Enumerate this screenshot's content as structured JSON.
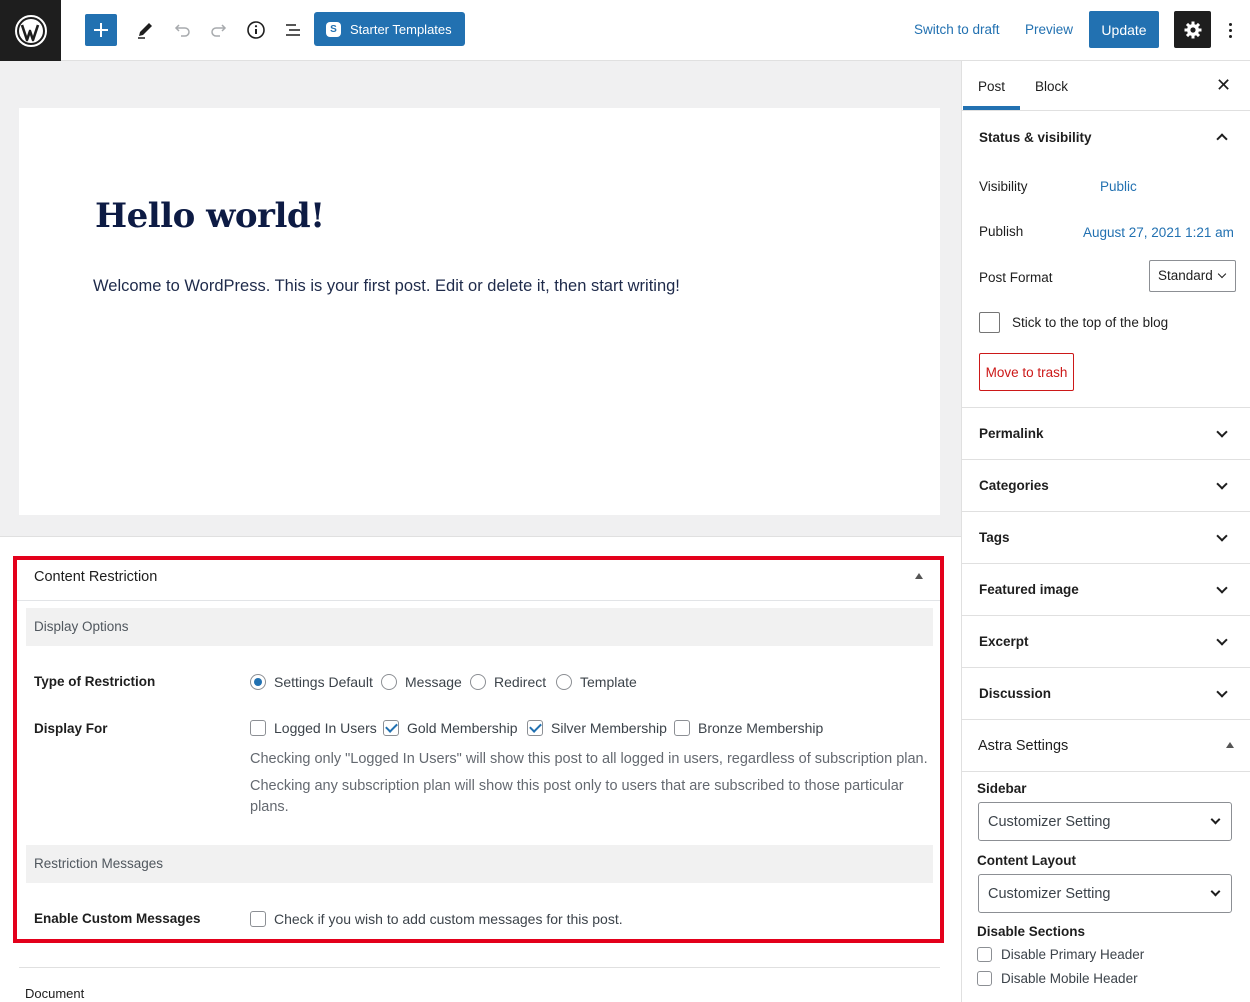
{
  "toolbar": {
    "starter_templates_label": "Starter Templates",
    "switch_to_draft_label": "Switch to draft",
    "preview_label": "Preview",
    "update_label": "Update"
  },
  "post": {
    "title": "Hello world!",
    "body": "Welcome to WordPress. This is your first post. Edit or delete it, then start writing!"
  },
  "content_restriction": {
    "title": "Content Restriction",
    "display_options_section": "Display Options",
    "type_label": "Type of Restriction",
    "type_options": [
      "Settings Default",
      "Message",
      "Redirect",
      "Template"
    ],
    "type_selected": "Settings Default",
    "display_for_label": "Display For",
    "display_for_options": [
      "Logged In Users",
      "Gold Membership",
      "Silver Membership",
      "Bronze Membership"
    ],
    "display_for_checked": [
      "Gold Membership",
      "Silver Membership"
    ],
    "desc_1": "Checking only \"Logged In Users\" will show this post to all logged in users, regardless of subscription plan.",
    "desc_2": "Checking any subscription plan will show this post only to users that are subscribed to those particular plans.",
    "restriction_messages_section": "Restriction Messages",
    "custom_messages_label": "Enable Custom Messages",
    "custom_messages_text": "Check if you wish to add custom messages for this post."
  },
  "footer": {
    "breadcrumb": "Document"
  },
  "sidebar": {
    "tabs": [
      "Post",
      "Block"
    ],
    "active_tab": "Post",
    "status_visibility": "Status & visibility",
    "visibility_label": "Visibility",
    "visibility_value": "Public",
    "publish_label": "Publish",
    "publish_value": "August 27, 2021 1:21 am",
    "post_format_label": "Post Format",
    "post_format_value": "Standard",
    "sticky_label": "Stick to the top of the blog",
    "trash_label": "Move to trash",
    "panels": [
      "Permalink",
      "Categories",
      "Tags",
      "Featured image",
      "Excerpt",
      "Discussion"
    ],
    "astra_settings": "Astra Settings",
    "sidebar_label": "Sidebar",
    "sidebar_value": "Customizer Setting",
    "content_layout_label": "Content Layout",
    "content_layout_value": "Customizer Setting",
    "disable_sections_label": "Disable Sections",
    "disable_primary_header": "Disable Primary Header",
    "disable_mobile_header": "Disable Mobile Header"
  },
  "colors": {
    "accent": "#2271b1",
    "highlight_border": "#e3001b",
    "danger": "#cc1818"
  }
}
